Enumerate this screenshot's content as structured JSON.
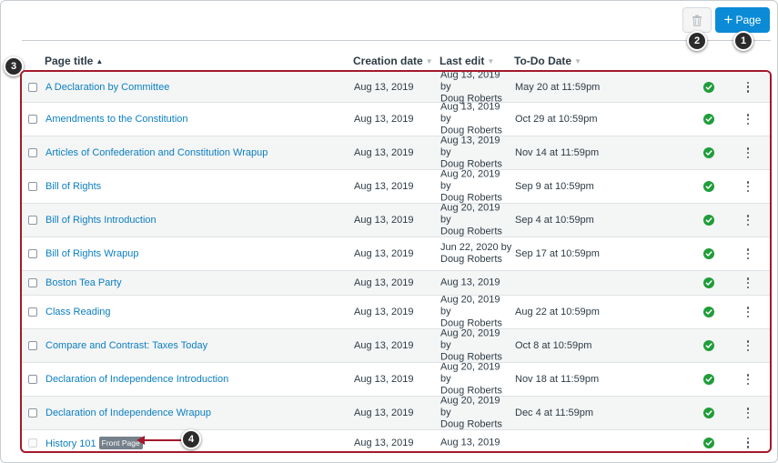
{
  "toolbar": {
    "add_page_label": "Page",
    "add_page_icon": "plus-icon",
    "delete_icon": "trash-icon",
    "primary_color": "#0b8bd6"
  },
  "markers": {
    "one": "1",
    "two": "2",
    "three": "3",
    "four": "4"
  },
  "table": {
    "columns": {
      "title": "Page title",
      "created": "Creation date",
      "edited": "Last edit",
      "todo": "To-Do Date"
    },
    "highlight_color": "#a3192b",
    "rows": [
      {
        "title": "A Declaration by Committee",
        "created": "Aug 13, 2019",
        "edit_date": "Aug 13, 2019 by",
        "edit_by": "Doug Roberts",
        "todo": "May 20 at 11:59pm",
        "published": true
      },
      {
        "title": "Amendments to the Constitution",
        "created": "Aug 13, 2019",
        "edit_date": "Aug 13, 2019 by",
        "edit_by": "Doug Roberts",
        "todo": "Oct 29 at 10:59pm",
        "published": true
      },
      {
        "title": "Articles of Confederation and Constitution Wrapup",
        "created": "Aug 13, 2019",
        "edit_date": "Aug 13, 2019 by",
        "edit_by": "Doug Roberts",
        "todo": "Nov 14 at 11:59pm",
        "published": true
      },
      {
        "title": "Bill of Rights",
        "created": "Aug 13, 2019",
        "edit_date": "Aug 20, 2019 by",
        "edit_by": "Doug Roberts",
        "todo": "Sep 9 at 10:59pm",
        "published": true
      },
      {
        "title": "Bill of Rights Introduction",
        "created": "Aug 13, 2019",
        "edit_date": "Aug 20, 2019 by",
        "edit_by": "Doug Roberts",
        "todo": "Sep 4 at 10:59pm",
        "published": true
      },
      {
        "title": "Bill of Rights Wrapup",
        "created": "Aug 13, 2019",
        "edit_date": "Jun 22, 2020 by",
        "edit_by": "Doug Roberts",
        "todo": "Sep 17 at 10:59pm",
        "published": true
      },
      {
        "title": "Boston Tea Party",
        "created": "Aug 13, 2019",
        "edit_date": "Aug 13, 2019",
        "edit_by": "",
        "todo": "",
        "published": true
      },
      {
        "title": "Class Reading",
        "created": "Aug 13, 2019",
        "edit_date": "Aug 20, 2019 by",
        "edit_by": "Doug Roberts",
        "todo": "Aug 22 at 10:59pm",
        "published": true
      },
      {
        "title": "Compare and Contrast: Taxes Today",
        "created": "Aug 13, 2019",
        "edit_date": "Aug 20, 2019 by",
        "edit_by": "Doug Roberts",
        "todo": "Oct 8 at 10:59pm",
        "published": true
      },
      {
        "title": "Declaration of Independence Introduction",
        "created": "Aug 13, 2019",
        "edit_date": "Aug 20, 2019 by",
        "edit_by": "Doug Roberts",
        "todo": "Nov 18 at 11:59pm",
        "published": true
      },
      {
        "title": "Declaration of Independence Wrapup",
        "created": "Aug 13, 2019",
        "edit_date": "Aug 20, 2019 by",
        "edit_by": "Doug Roberts",
        "todo": "Dec 4 at 11:59pm",
        "published": true
      },
      {
        "title": "History 101",
        "badge": "Front Page",
        "created": "Aug 13, 2019",
        "edit_date": "Aug 13, 2019",
        "edit_by": "",
        "todo": "",
        "published": true
      }
    ]
  }
}
